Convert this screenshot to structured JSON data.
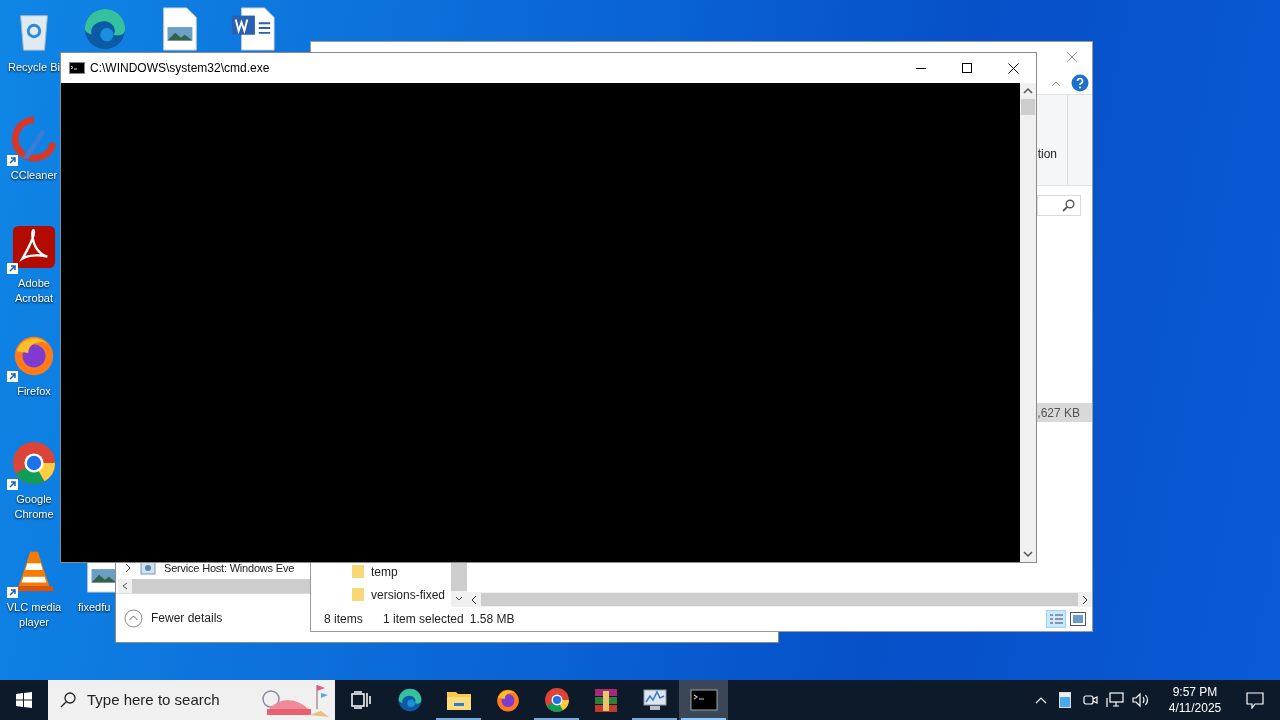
{
  "desktop_icons": [
    {
      "kind": "recycle-bin",
      "label": "Recycle Bi"
    },
    {
      "kind": "ccleaner",
      "label": "CCleaner"
    },
    {
      "kind": "acrobat",
      "label": "Adobe Acrobat"
    },
    {
      "kind": "firefox",
      "label": "Firefox"
    },
    {
      "kind": "chrome",
      "label": "Google Chrome"
    },
    {
      "kind": "vlc",
      "label": "VLC media player"
    },
    {
      "kind": "image-file",
      "label": "fixedfu"
    }
  ],
  "top_icons": [
    {
      "kind": "edge"
    },
    {
      "kind": "image-file"
    },
    {
      "kind": "word-doc"
    }
  ],
  "task_manager": {
    "row": "Service Host: Windows Eve",
    "footer": "Fewer details"
  },
  "explorer": {
    "ribbon_fragment": "tion",
    "size_fragment": ",627 KB",
    "files": [
      {
        "name": "temp"
      },
      {
        "name": "versions-fixed"
      }
    ],
    "status": {
      "count": "8 items",
      "selection": "1 item selected",
      "size": "1.58 MB"
    }
  },
  "cmd": {
    "title": "C:\\WINDOWS\\system32\\cmd.exe"
  },
  "taskbar": {
    "search_placeholder": "Type here to search",
    "apps": [
      {
        "kind": "task-view",
        "running": false,
        "selected": false
      },
      {
        "kind": "edge",
        "running": false,
        "selected": false
      },
      {
        "kind": "folder",
        "running": true,
        "selected": false
      },
      {
        "kind": "firefox",
        "running": false,
        "selected": false
      },
      {
        "kind": "chrome",
        "running": true,
        "selected": false
      },
      {
        "kind": "winrar",
        "running": false,
        "selected": false
      },
      {
        "kind": "task-manager",
        "running": true,
        "selected": false
      },
      {
        "kind": "cmd",
        "running": true,
        "selected": true
      }
    ],
    "time": "9:57 PM",
    "date": "4/11/2025"
  }
}
